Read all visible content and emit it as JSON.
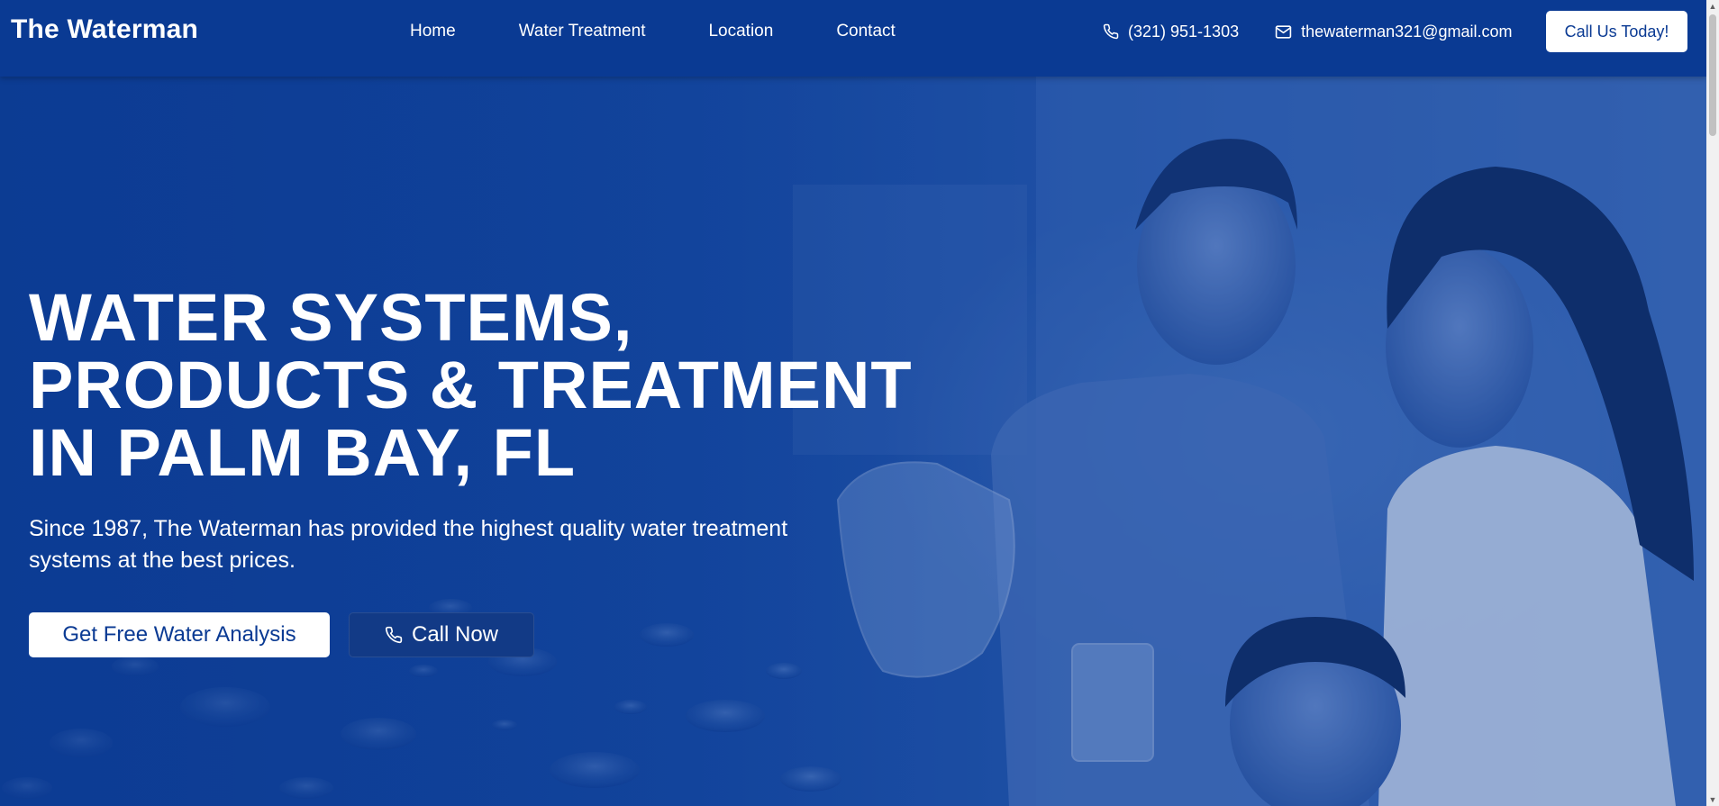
{
  "header": {
    "brand": "The Waterman",
    "nav": [
      {
        "label": "Home"
      },
      {
        "label": "Water Treatment"
      },
      {
        "label": "Location"
      },
      {
        "label": "Contact"
      }
    ],
    "phone": "(321) 951-1303",
    "email": "thewaterman321@gmail.com",
    "cta_label": "Call Us Today!"
  },
  "hero": {
    "title": "WATER SYSTEMS,\nPRODUCTS & TREATMENT\nIN PALM BAY, FL",
    "subtitle": "Since 1987, The Waterman has provided the highest quality water treatment systems at the best prices.",
    "primary_button": "Get Free Water Analysis",
    "secondary_button": "Call Now"
  },
  "colors": {
    "header_bg": "#0a3a93",
    "hero_overlay": "#154aa3",
    "button_text": "#0a3a93"
  }
}
